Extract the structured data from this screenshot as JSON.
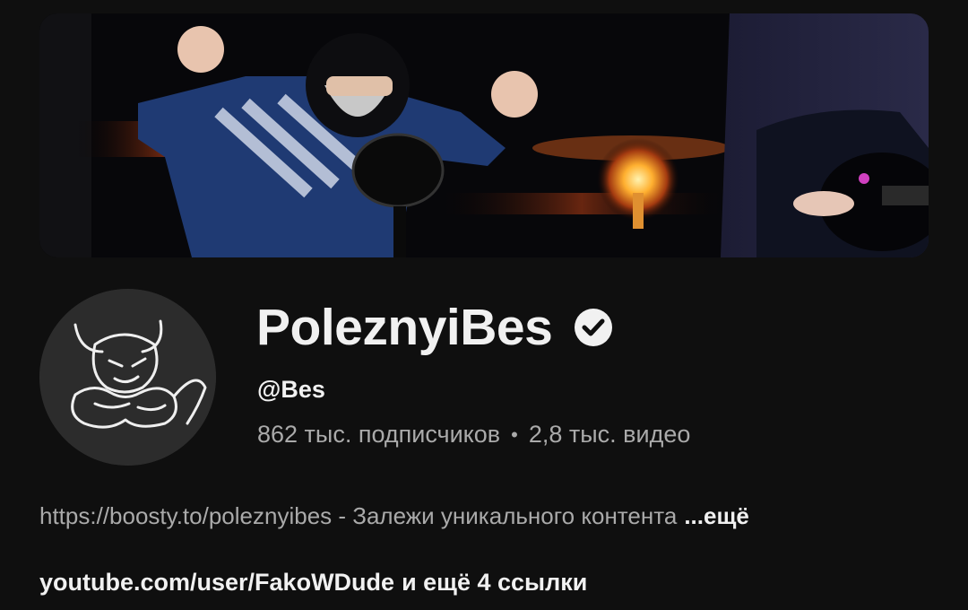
{
  "channel": {
    "name": "PoleznyiBes",
    "handle": "@Bes",
    "subscribers": "862 тыс. подписчиков",
    "separator": "•",
    "videos": "2,8 тыс. видео",
    "verified": true
  },
  "description": {
    "text": "https://boosty.to/poleznyibes - Залежи уникального контента",
    "more_label": "...ещё"
  },
  "links": {
    "primary": "youtube.com/user/FakoWDude",
    "extra": "и ещё 4 ссылки"
  },
  "colors": {
    "background": "#0f0f0f",
    "primary_text": "#f1f1f1",
    "secondary_text": "#aaaaaa"
  },
  "icons": {
    "verified": "verified-check-icon"
  }
}
